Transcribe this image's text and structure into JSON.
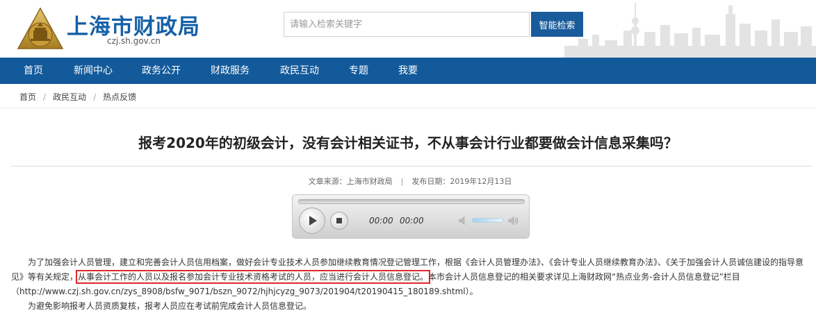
{
  "header": {
    "site_title": "上海市财政局",
    "site_domain": "czj.sh.gov.cn",
    "search_placeholder": "请输入检索关键字",
    "search_button": "智能检索",
    "accent_color": "#135a9b"
  },
  "nav": {
    "items": [
      {
        "label": "首页"
      },
      {
        "label": "新闻中心"
      },
      {
        "label": "政务公开"
      },
      {
        "label": "财政服务"
      },
      {
        "label": "政民互动"
      },
      {
        "label": "专题"
      },
      {
        "label": "我要"
      }
    ]
  },
  "breadcrumb": {
    "items": [
      {
        "label": "首页"
      },
      {
        "label": "政民互动"
      },
      {
        "label": "热点反馈"
      }
    ]
  },
  "article": {
    "title": "报考2020年的初级会计，没有会计相关证书，不从事会计行业都要做会计信息采集吗？",
    "source": "文章来源：上海市财政局",
    "date": "发布日期：2019年12月13日",
    "paragraph1_a": "为了加强会计人员管理，建立和完善会计人员信用档案，做好会计专业技术人员参加继续教育情况登记管理工作，根据《会计人员管理办法》、《会计专业人员继续教育办法》、《关于加强会计人员诚信建设的指导意见》等有关规定，",
    "paragraph1_highlight": "从事会计工作的人员以及报名参加会计专业技术资格考试的人员，应当进行会计人员信息登记。",
    "paragraph1_b": "本市会计人员信息登记的相关要求详见上海财政网“热点业务-会计人员信息登记”栏目（http://www.czj.sh.gov.cn/zys_8908/bsfw_9071/bszn_9072/hjhjcyzg_9073/201904/t20190415_180189.shtml）。",
    "paragraph2": "为避免影响报考人员资质复核，报考人员应在考试前完成会计人员信息登记。",
    "highlight_color": "#e1262b"
  },
  "player": {
    "current_time": "00:00",
    "duration": "00:00",
    "play_icon": "play-icon",
    "stop_icon": "stop-icon",
    "volume_icon": "speaker-icon"
  }
}
